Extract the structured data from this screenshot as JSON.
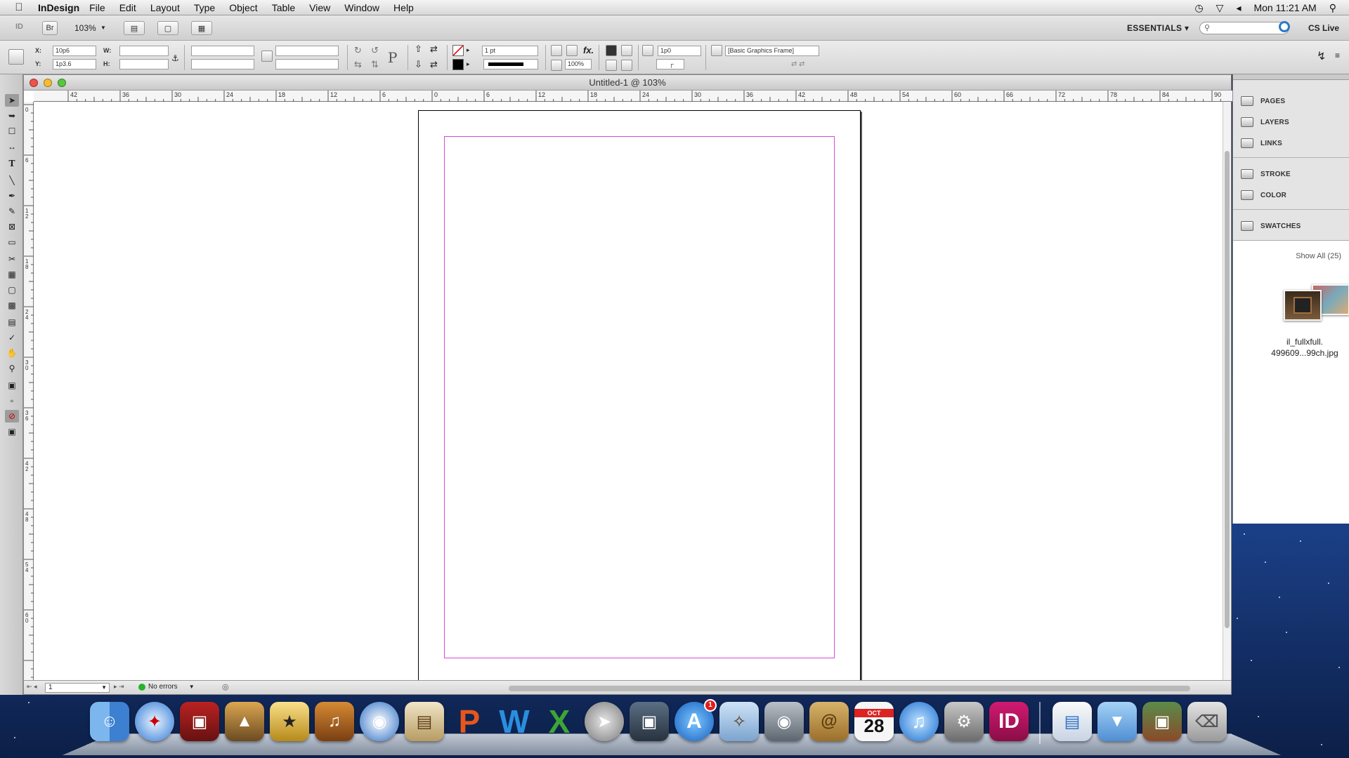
{
  "menubar": {
    "app_name": "InDesign",
    "menus": [
      "File",
      "Edit",
      "Layout",
      "Type",
      "Object",
      "Table",
      "View",
      "Window",
      "Help"
    ],
    "clock": "Mon 11:21 AM"
  },
  "appbar": {
    "logo": "ID",
    "bridge": "Br",
    "zoom": "103%",
    "workspace": "ESSENTIALS",
    "cs_live": "CS Live"
  },
  "control": {
    "x_label": "X:",
    "x_value": "10p6",
    "y_label": "Y:",
    "y_value": "1p3.6",
    "w_label": "W:",
    "h_label": "H:",
    "stroke_weight": "1 pt",
    "opacity": "100%",
    "offset": "1p0",
    "object_style": "[Basic Graphics Frame]"
  },
  "document": {
    "title": "Untitled-1 @ 103%",
    "ruler_h": [
      "42",
      "36",
      "30",
      "24",
      "18",
      "12",
      "6",
      "0",
      "6",
      "12",
      "18",
      "24",
      "30",
      "36",
      "42",
      "48",
      "54",
      "60",
      "66",
      "72",
      "78",
      "84",
      "90"
    ],
    "ruler_v": [
      "0",
      "6",
      "1 2",
      "1 8",
      "2 4",
      "3 0",
      "3 6",
      "4 2",
      "4 8",
      "5 4",
      "6 0"
    ],
    "page_number": "1",
    "preflight": "No errors"
  },
  "panels": {
    "items": [
      "PAGES",
      "LAYERS",
      "LINKS",
      "STROKE",
      "COLOR",
      "SWATCHES"
    ],
    "show_all": "Show All (25)",
    "link_file_line1": "il_fullxfull.",
    "link_file_line2": "499609...99ch.jpg"
  },
  "dock": {
    "calendar_month": "OCT",
    "calendar_day": "28",
    "appstore_badge": "1"
  },
  "colors": {
    "margin_guide": "#d24bd4",
    "preflight_ok": "#27b22c",
    "indesign_pink": "#b0125f"
  }
}
